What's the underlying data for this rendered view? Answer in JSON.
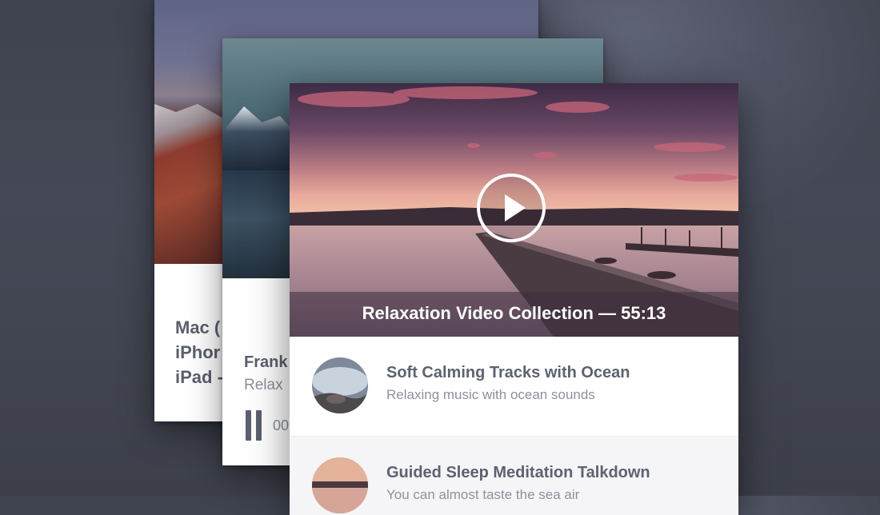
{
  "back_card": {
    "lines": [
      "Mac (",
      "iPhor",
      "iPad -"
    ]
  },
  "middle_card": {
    "title": "Frank",
    "subtitle": "Relax",
    "time": "00"
  },
  "front_card": {
    "caption": "Relaxation Video Collection — 55:13",
    "tracks": [
      {
        "title": "Soft Calming Tracks with Ocean",
        "description": "Relaxing music with ocean sounds"
      },
      {
        "title": "Guided Sleep Meditation Talkdown",
        "description": "You can almost taste the sea air"
      }
    ]
  },
  "colors": {
    "background": "#424653",
    "card": "#ffffff",
    "title_text": "#5d6270",
    "secondary_text": "#8d919c"
  }
}
